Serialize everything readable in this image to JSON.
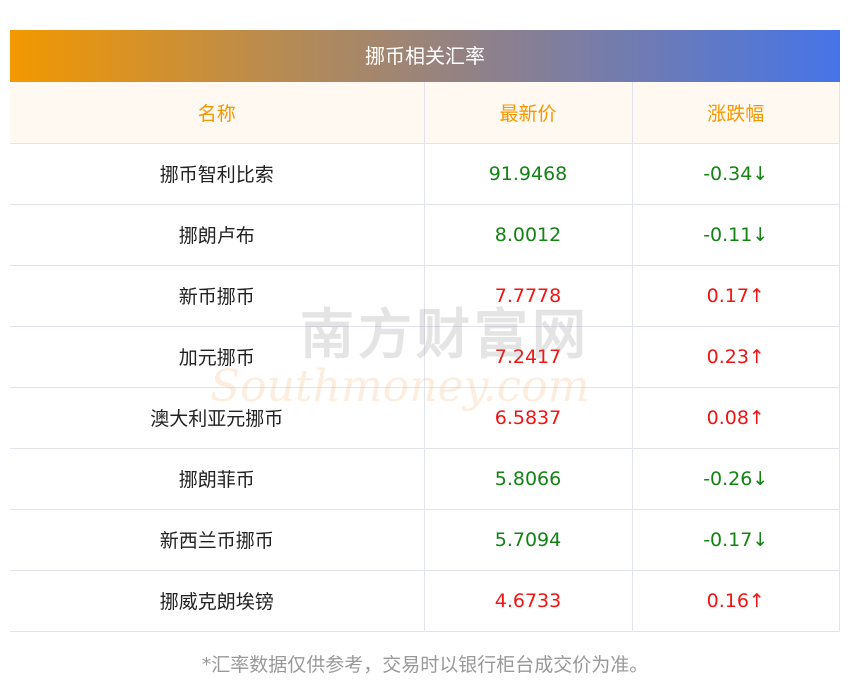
{
  "title": "挪币相关汇率",
  "columns": [
    "名称",
    "最新价",
    "涨跌幅"
  ],
  "rows": [
    {
      "name": "挪币智利比索",
      "price": "91.9468",
      "change": "-0.34↓",
      "dir": "down"
    },
    {
      "name": "挪朗卢布",
      "price": "8.0012",
      "change": "-0.11↓",
      "dir": "down"
    },
    {
      "name": "新币挪币",
      "price": "7.7778",
      "change": "0.17↑",
      "dir": "up"
    },
    {
      "name": "加元挪币",
      "price": "7.2417",
      "change": "0.23↑",
      "dir": "up"
    },
    {
      "name": "澳大利亚元挪币",
      "price": "6.5837",
      "change": "0.08↑",
      "dir": "up"
    },
    {
      "name": "挪朗菲币",
      "price": "5.8066",
      "change": "-0.26↓",
      "dir": "down"
    },
    {
      "name": "新西兰币挪币",
      "price": "5.7094",
      "change": "-0.17↓",
      "dir": "down"
    },
    {
      "name": "挪威克朗埃镑",
      "price": "4.6733",
      "change": "0.16↑",
      "dir": "up"
    }
  ],
  "watermark": {
    "cn": "南方财富网",
    "en": "Southmoney.com"
  },
  "footer": "*汇率数据仅供参考，交易时以银行柜台成交价为准。",
  "colors": {
    "up": "#f01414",
    "down": "#148214",
    "header": "#f39800"
  }
}
